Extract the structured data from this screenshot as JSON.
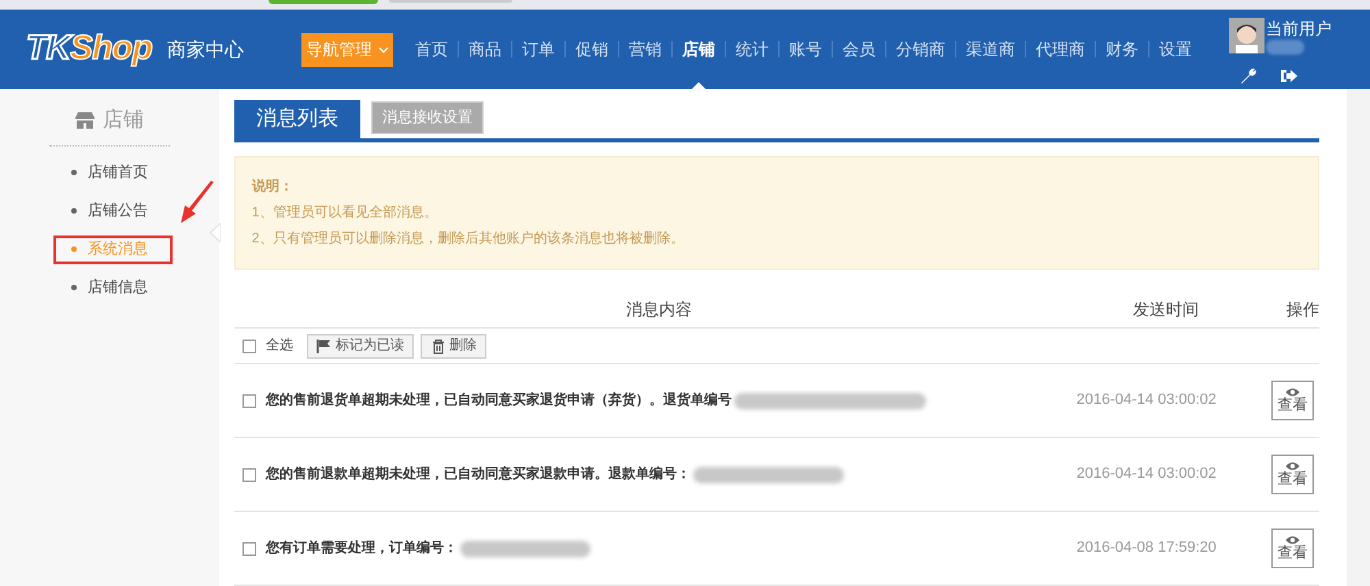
{
  "header": {
    "logo": {
      "part_1": "TK",
      "part_2": "Shop"
    },
    "subtitle": "商家中心",
    "nav_button": "导航管理",
    "nav": [
      {
        "label": "首页",
        "selected": false
      },
      {
        "label": "商品",
        "selected": false
      },
      {
        "label": "订单",
        "selected": false
      },
      {
        "label": "促销",
        "selected": false
      },
      {
        "label": "营销",
        "selected": false
      },
      {
        "label": "店铺",
        "selected": true
      },
      {
        "label": "统计",
        "selected": false
      },
      {
        "label": "账号",
        "selected": false
      },
      {
        "label": "会员",
        "selected": false
      },
      {
        "label": "分销商",
        "selected": false
      },
      {
        "label": "渠道商",
        "selected": false
      },
      {
        "label": "代理商",
        "selected": false
      },
      {
        "label": "财务",
        "selected": false
      },
      {
        "label": "设置",
        "selected": false
      }
    ],
    "user": {
      "label": "当前用户",
      "name_redacted": true
    }
  },
  "sidebar": {
    "title": "店铺",
    "items": [
      {
        "label": "店铺首页",
        "selected": false,
        "annotated": false
      },
      {
        "label": "店铺公告",
        "selected": false,
        "annotated": false
      },
      {
        "label": "系统消息",
        "selected": true,
        "annotated": true
      },
      {
        "label": "店铺信息",
        "selected": false,
        "annotated": false
      }
    ]
  },
  "tabs": [
    {
      "label": "消息列表",
      "selected": true
    },
    {
      "label": "消息接收设置",
      "selected": false
    }
  ],
  "notice": {
    "title": "说明：",
    "lines": [
      "1、管理员可以看见全部消息。",
      "2、只有管理员可以删除消息，删除后其他账户的该条消息也将被删除。"
    ]
  },
  "table": {
    "columns": [
      "消息内容",
      "发送时间",
      "操作"
    ],
    "toolbar": {
      "select_all": "全选",
      "select_all_checked": false,
      "buttons": [
        "标记为已读",
        "删除"
      ]
    },
    "rows": [
      {
        "message": "您的售前退货单超期未处理，已自动同意买家退货申请（弃货）。退货单编号",
        "checked": false,
        "time": "2016-04-14 03:00:02",
        "action": "查看"
      },
      {
        "message": "您的售前退款单超期未处理，已自动同意买家退款申请。退款单编号：",
        "checked": false,
        "time": "2016-04-14 03:00:02",
        "action": "查看"
      },
      {
        "message": "您有订单需要处理，订单编号：",
        "checked": false,
        "time": "2016-04-08 17:59:20",
        "action": "查看"
      }
    ]
  }
}
